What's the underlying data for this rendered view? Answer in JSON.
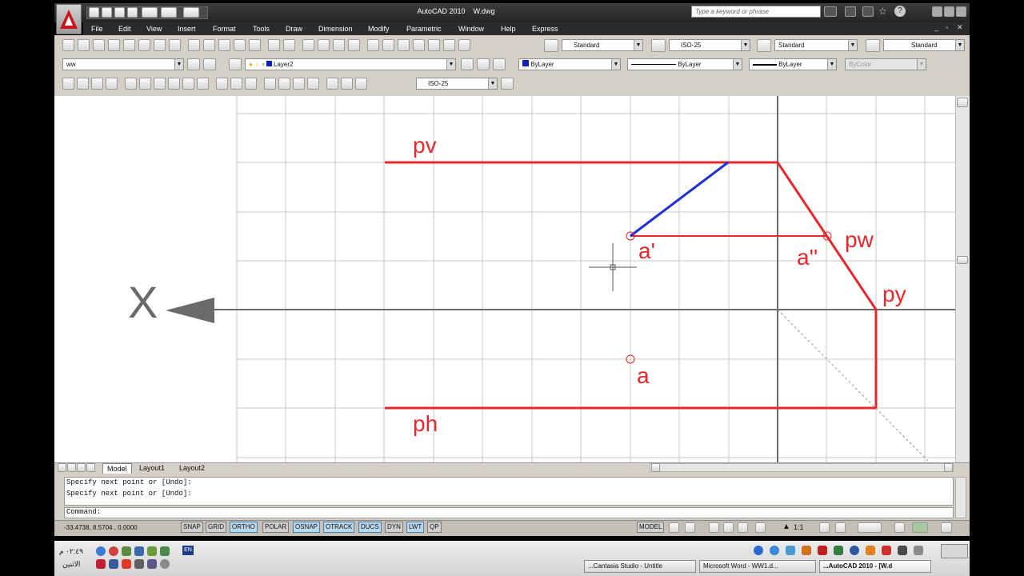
{
  "window": {
    "title": "AutoCAD 2010    W.dwg"
  },
  "search": {
    "placeholder": "Type a keyword or phrase"
  },
  "menu": [
    "File",
    "Edit",
    "View",
    "Insert",
    "Format",
    "Tools",
    "Draw",
    "Dimension",
    "Modify",
    "Parametric",
    "Window",
    "Help",
    "Express"
  ],
  "styles": {
    "text_style": "Standard",
    "dim_style": "ISO-25",
    "table_style": "Standard",
    "multileader_style": "Standard"
  },
  "layers": {
    "workspace": "ww",
    "current_layer": "Layer2",
    "color": "ByLayer",
    "linetype": "ByLayer",
    "lineweight": "ByLayer",
    "plotstyle": "ByColor"
  },
  "dim_toolbar": {
    "dim_style": "ISO-25"
  },
  "drawing": {
    "labels": {
      "pv": "pv",
      "a_prime": "a'",
      "a_double": "a''",
      "pw": "pw",
      "py": "py",
      "a": "a",
      "ph": "ph",
      "x_axis": "X"
    },
    "colors": {
      "red": "#e8262b",
      "blue": "#1d2fd4",
      "grid": "#c8c8c8",
      "axis": "#6a6a6a"
    }
  },
  "tabs": {
    "model": "Model",
    "layout1": "Layout1",
    "layout2": "Layout2"
  },
  "command": {
    "lines": [
      "Specify next point or [Undo]:",
      "Specify next point or [Undo]:"
    ],
    "prompt": "Command:"
  },
  "status": {
    "coords": "-33.4738, 8.5704 , 0.0000",
    "toggles": [
      {
        "label": "SNAP",
        "on": false
      },
      {
        "label": "GRID",
        "on": false
      },
      {
        "label": "ORTHO",
        "on": true
      },
      {
        "label": "POLAR",
        "on": false
      },
      {
        "label": "OSNAP",
        "on": true
      },
      {
        "label": "OTRACK",
        "on": true
      },
      {
        "label": "DUCS",
        "on": true
      },
      {
        "label": "DYN",
        "on": false
      },
      {
        "label": "LWT",
        "on": true
      },
      {
        "label": "QP",
        "on": false
      }
    ],
    "model": "MODEL",
    "scale": "1:1"
  },
  "taskbar": {
    "time": "٠٢:٤٩ م",
    "day": "الاثنين",
    "lang": "EN",
    "items": [
      {
        "label": "...Cantasia Studio - Untitle"
      },
      {
        "label": "Microsoft Word - WW1.d..."
      },
      {
        "label": "...AutoCAD 2010 - [W.d"
      }
    ]
  }
}
